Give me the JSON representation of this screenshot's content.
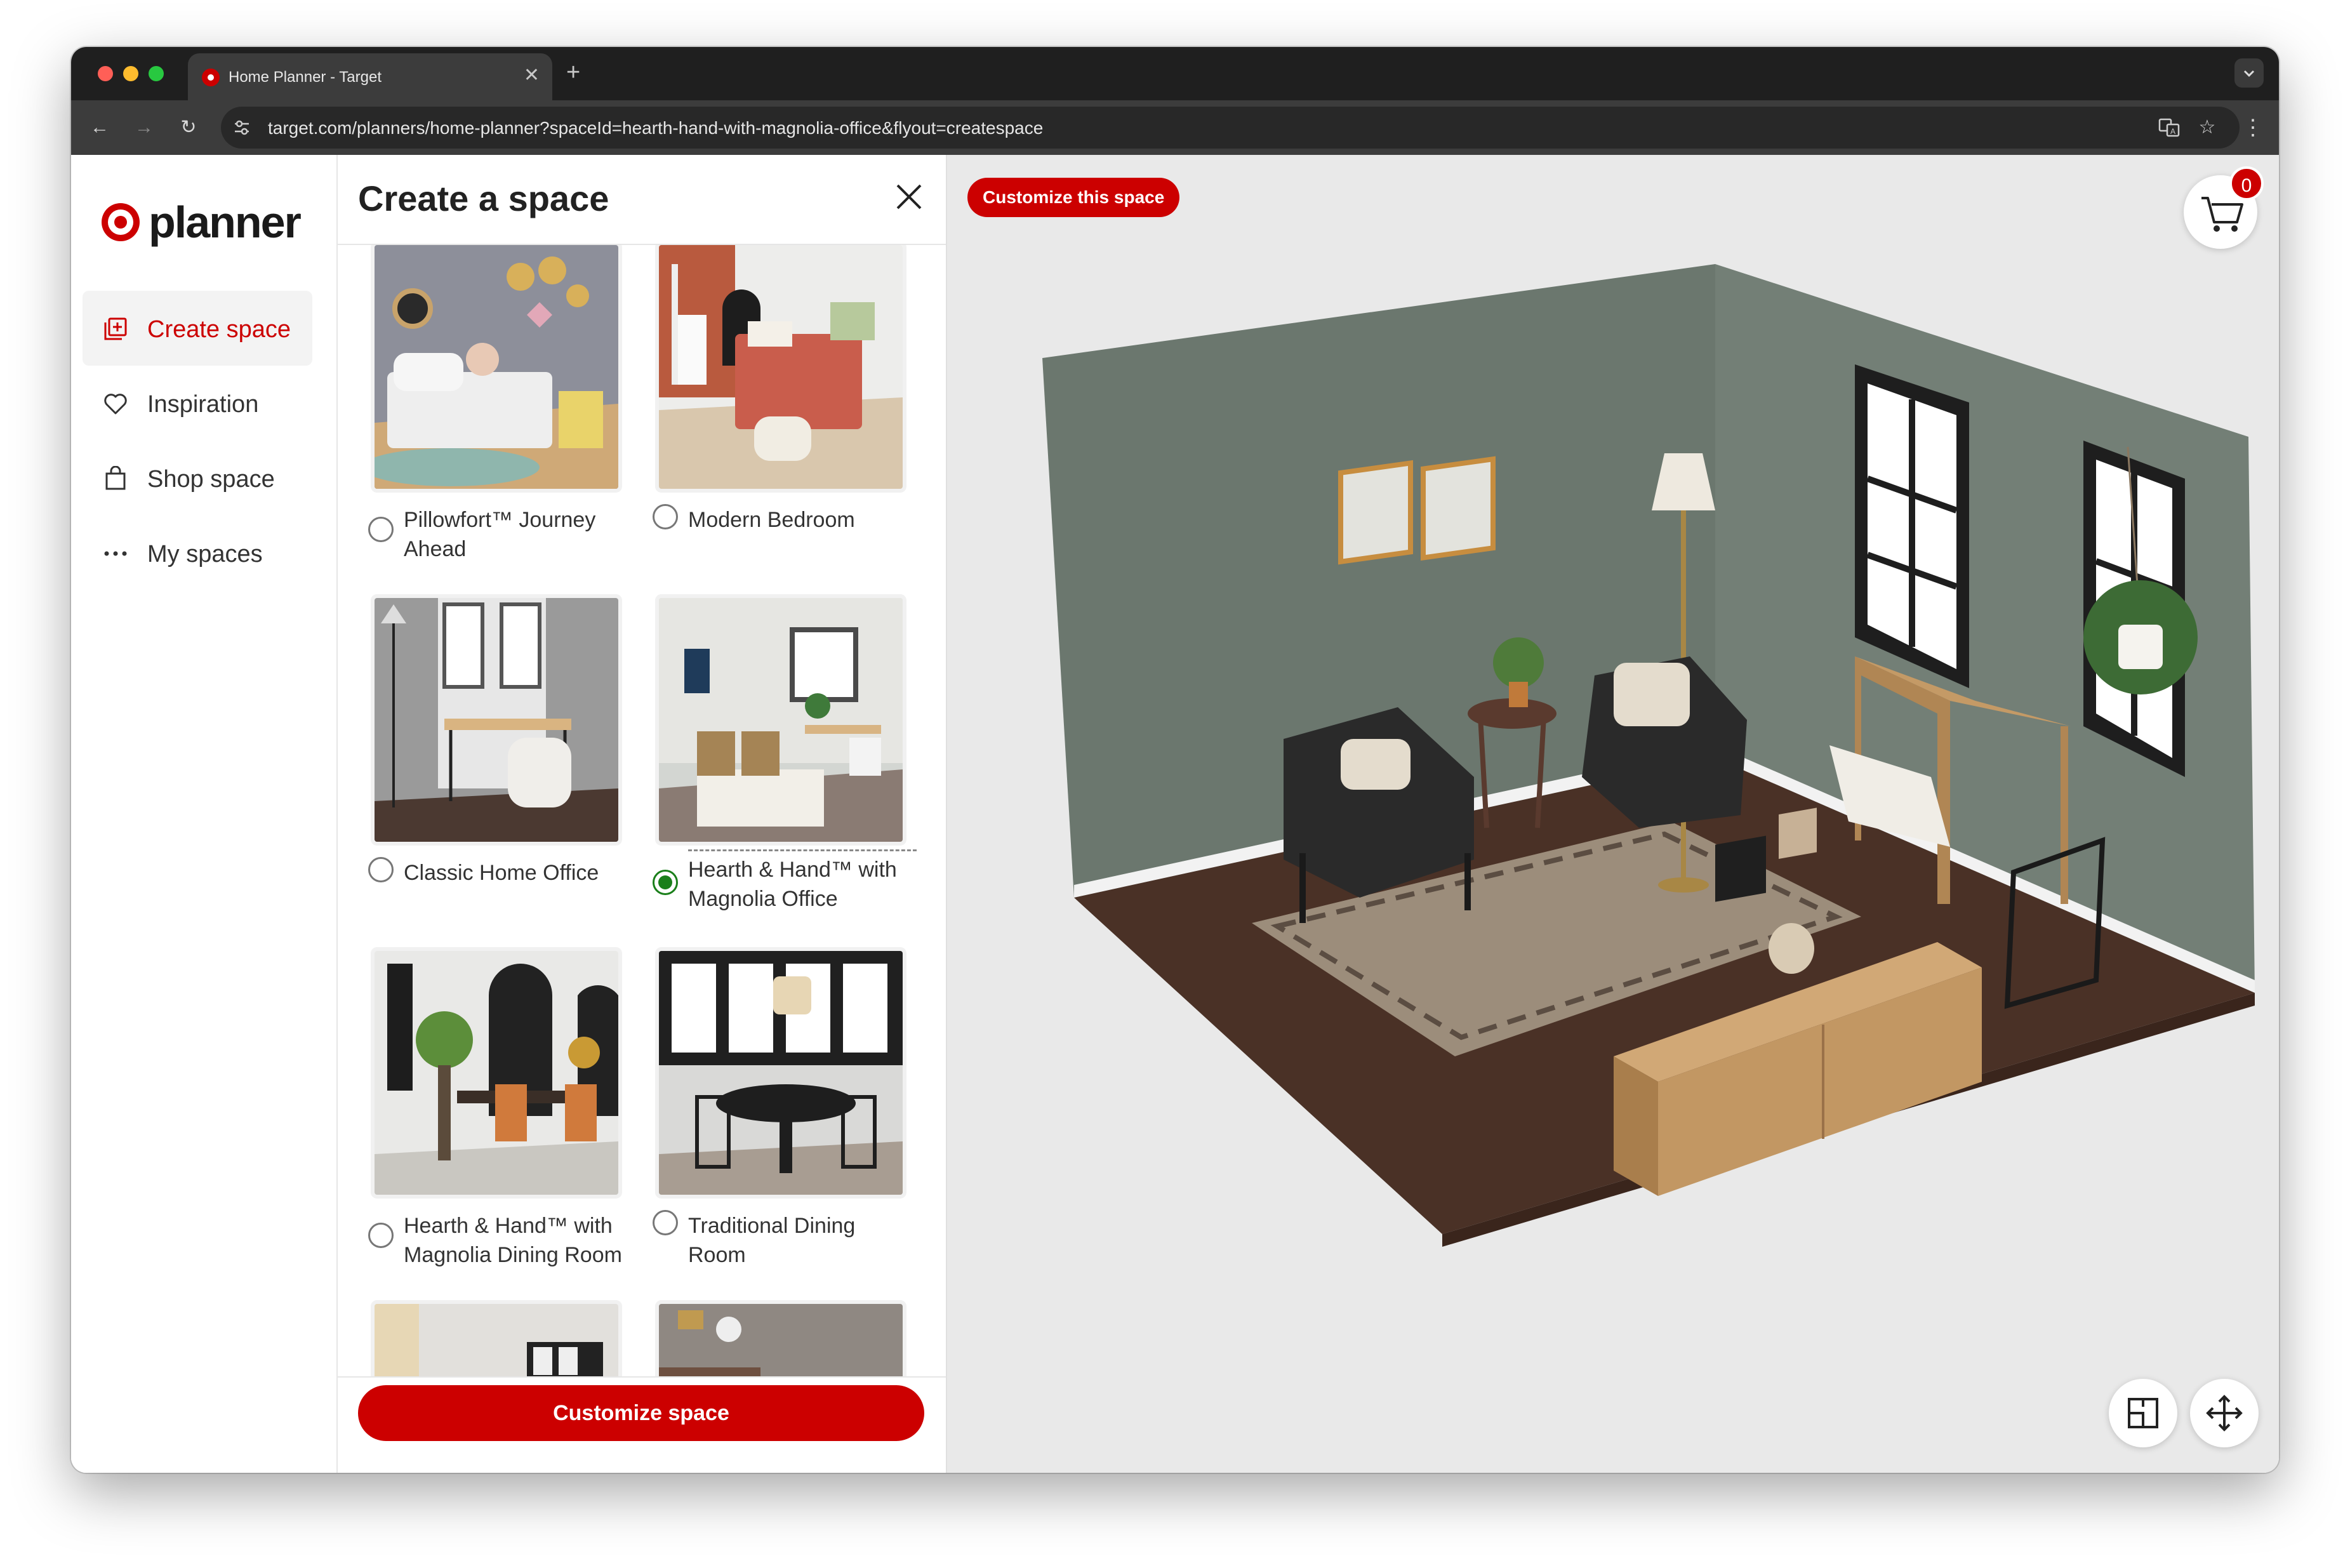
{
  "browser": {
    "tab_title": "Home Planner - Target",
    "tab_close": "✕",
    "new_tab": "+",
    "tab_dropdown": "⌄",
    "url": "target.com/planners/home-planner?spaceId=hearth-hand-with-magnolia-office&flyout=createspace",
    "back": "←",
    "forward": "→",
    "reload": "↻",
    "translate_icon": "translate-icon",
    "star": "☆",
    "menu": "⋮"
  },
  "sidebar": {
    "logo_text": "planner",
    "items": [
      {
        "label": "Create space",
        "icon": "create-space-icon",
        "active": true
      },
      {
        "label": "Inspiration",
        "icon": "heart-icon",
        "active": false
      },
      {
        "label": "Shop space",
        "icon": "shopping-bag-icon",
        "active": false
      },
      {
        "label": "My spaces",
        "icon": "more-dots-icon",
        "active": false
      }
    ]
  },
  "panel": {
    "title": "Create a space",
    "spaces": [
      {
        "label": "Pillowfort™ Journey Ahead",
        "selected": false
      },
      {
        "label": "Modern Bedroom",
        "selected": false
      },
      {
        "label": "Classic Home Office",
        "selected": false
      },
      {
        "label": "Hearth & Hand™ with Magnolia Office",
        "selected": true
      },
      {
        "label": "Hearth & Hand™ with Magnolia Dining Room",
        "selected": false
      },
      {
        "label": "Traditional Dining Room",
        "selected": false
      }
    ],
    "footer_button": "Customize space"
  },
  "viewport": {
    "customize_pill": "Customize this space",
    "cart_count": "0"
  },
  "colors": {
    "brand": "#cc0000",
    "selected_radio": "#1a7f1a",
    "wall": "#6f7b72",
    "floor": "#4a3126"
  }
}
